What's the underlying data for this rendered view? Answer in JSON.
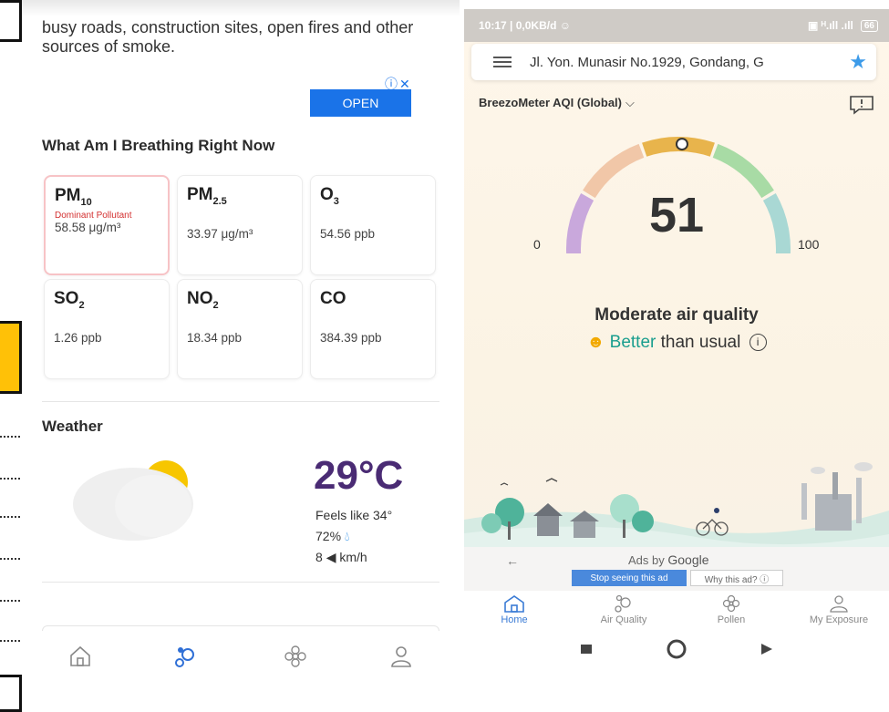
{
  "left_screen": {
    "intro_text": "busy roads, construction sites, open fires and other sources of smoke.",
    "ad": {
      "info_icons": "ⓘ✕",
      "open_label": "OPEN"
    },
    "breathing_title": "What Am I Breathing Right Now",
    "pollutants": [
      {
        "name": "PM",
        "sub": "10",
        "dominant_label": "Dominant Pollutant",
        "value": "58.58 μg/m³"
      },
      {
        "name": "PM",
        "sub": "2.5",
        "value": "33.97 μg/m³"
      },
      {
        "name": "O",
        "sub": "3",
        "value": "54.56 ppb"
      },
      {
        "name": "SO",
        "sub": "2",
        "value": "1.26 ppb"
      },
      {
        "name": "NO",
        "sub": "2",
        "value": "18.34 ppb"
      },
      {
        "name": "CO",
        "sub": "",
        "value": "384.39 ppb"
      }
    ],
    "weather": {
      "title": "Weather",
      "temperature": "29°C",
      "feels_like": "Feels like 34°",
      "humidity": "72%",
      "wind_speed": "8",
      "wind_unit": "km/h"
    }
  },
  "right_screen": {
    "status_bar": {
      "left": "10:17 | 0,0KB/d ☺",
      "signal": "▣ ᴴ.ıll .ıll",
      "battery": "66"
    },
    "address": "Jl. Yon. Munasir No.1929, Gondang, G",
    "index_name": "BreezoMeter AQI (Global)",
    "aqi": {
      "value": "51",
      "min": "0",
      "max": "100",
      "level": 0.51
    },
    "quality_label": "Moderate air quality",
    "comparison": {
      "better": "Better",
      "rest": "than usual"
    },
    "ads": {
      "back": "←",
      "ads_by": "Ads by",
      "google": "Google",
      "stop": "Stop seeing this ad",
      "why": "Why this ad? ⓘ"
    },
    "nav": [
      {
        "label": "Home"
      },
      {
        "label": "Air Quality"
      },
      {
        "label": "Pollen"
      },
      {
        "label": "My Exposure"
      }
    ],
    "colors": {
      "purple": "#c9a8dc",
      "peach": "#f1c7a8",
      "amber": "#e8b44c",
      "green": "#a8dba5",
      "teal": "#a9d8d4",
      "accent": "#3a7bd5"
    }
  }
}
